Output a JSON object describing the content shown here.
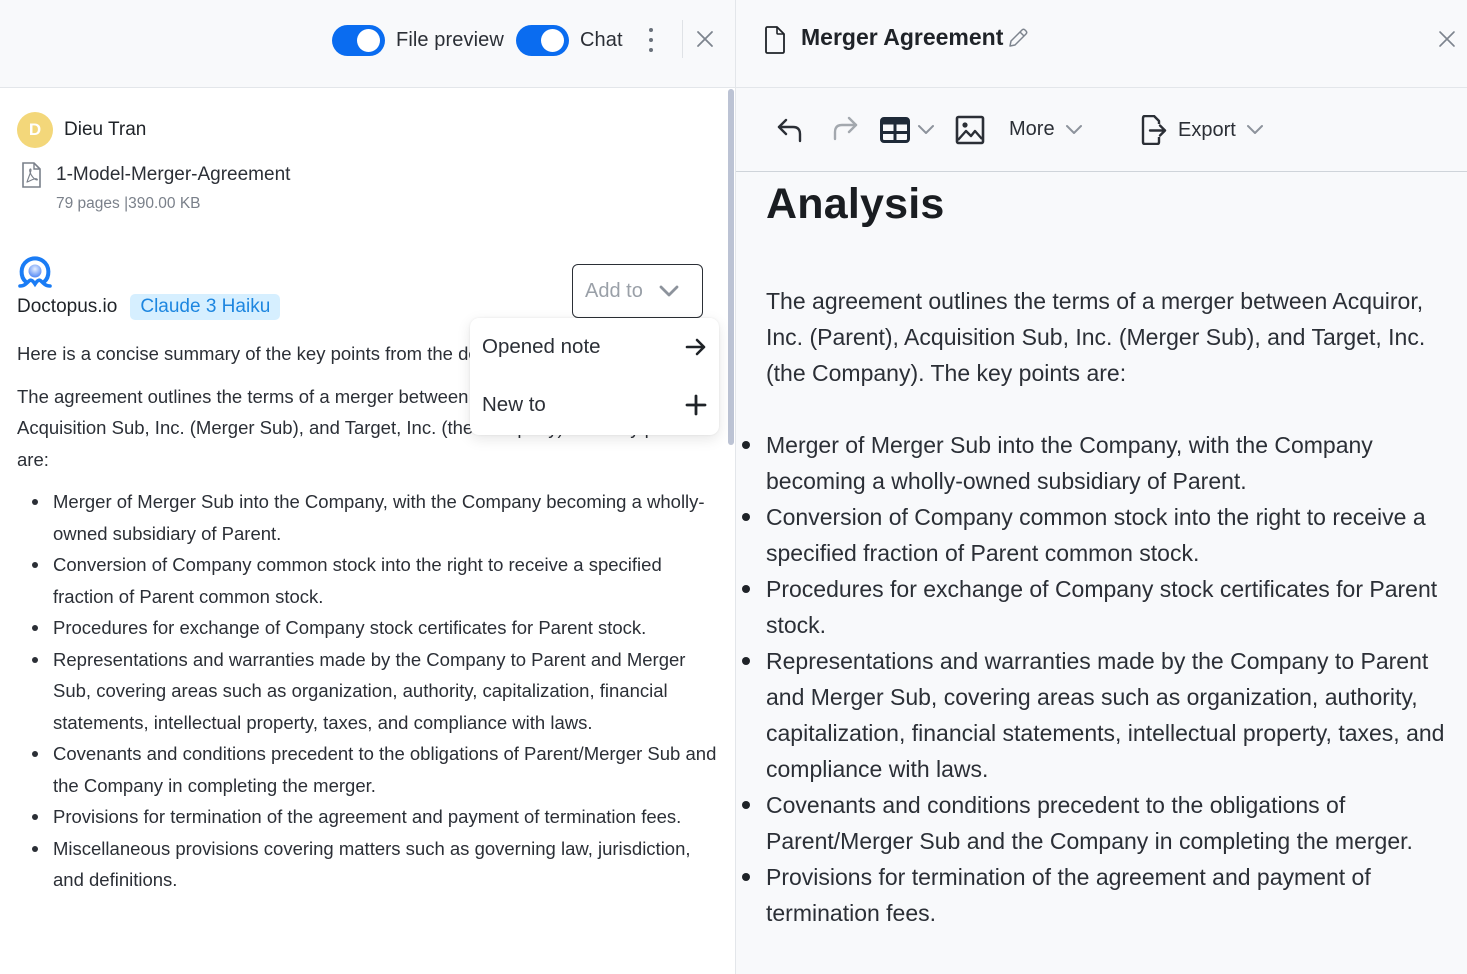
{
  "chat_panel": {
    "header": {
      "file_preview_toggle": {
        "label": "File preview",
        "on": true
      },
      "chat_toggle": {
        "label": "Chat",
        "on": true
      },
      "more_icon": "kebab-vertical-icon",
      "close_icon": "close-icon"
    },
    "user_message": {
      "avatar_initial": "D",
      "avatar_color": "#f3d77a",
      "user_name": "Dieu Tran",
      "attachment": {
        "icon": "pdf-file-icon",
        "file_name": "1-Model-Merger-Agreement",
        "meta": "79 pages |390.00 KB"
      }
    },
    "assistant_message": {
      "brand_name": "Doctopus.io",
      "model_badge": "Claude 3 Haiku",
      "add_to_button": "Add to",
      "add_to_menu": [
        {
          "label": "Opened note",
          "icon": "arrow-right-icon"
        },
        {
          "label": "New to",
          "icon": "plus-icon"
        }
      ],
      "intro": "Here is a concise summary of the key points from the document:",
      "paragraph": "The agreement outlines the terms of a merger between Acquiror, Inc. (Parent), Acquisition Sub, Inc. (Merger Sub), and Target, Inc. (the Company). The key points are:",
      "bullets": [
        "Merger of Merger Sub into the Company, with the Company becoming a wholly-owned subsidiary of Parent.",
        "Conversion of Company common stock into the right to receive a specified fraction of Parent common stock.",
        "Procedures for exchange of Company stock certificates for Parent stock.",
        "Representations and warranties made by the Company to Parent and Merger Sub, covering areas such as organization, authority, capitalization, financial statements, intellectual property, taxes, and compliance with laws.",
        "Covenants and conditions precedent to the obligations of Parent/Merger Sub and the Company in completing the merger.",
        "Provisions for termination of the agreement and payment of termination fees.",
        "Miscellaneous provisions covering matters such as governing law, jurisdiction, and definitions."
      ]
    }
  },
  "note_panel": {
    "title": "Merger Agreement",
    "toolbar": {
      "undo": "undo-icon",
      "redo": "redo-icon",
      "table": "table-icon",
      "image": "image-icon",
      "more_label": "More",
      "export_label": "Export"
    },
    "document": {
      "heading": "Analysis",
      "paragraph": "The agreement outlines the terms of a merger between Acquiror, Inc. (Parent), Acquisition Sub, Inc. (Merger Sub), and Target, Inc. (the Company). The key points are:",
      "bullets": [
        "Merger of Merger Sub into the Company, with the Company becoming a wholly-owned subsidiary of Parent.",
        "Conversion of Company common stock into the right to receive a specified fraction of Parent common stock.",
        "Procedures for exchange of Company stock certificates for Parent stock.",
        "Representations and warranties made by the Company to Parent and Merger Sub, covering areas such as organization, authority, capitalization, financial statements, intellectual property, taxes, and compliance with laws.",
        "Covenants and conditions precedent to the obligations of Parent/Merger Sub and the Company in completing the merger.",
        "Provisions for termination of the agreement and payment of termination fees."
      ]
    }
  },
  "colors": {
    "toggle_on": "#0a6cf0",
    "badge_bg": "#d6efff",
    "badge_text": "#1d86e0",
    "brand_blue": "#1a7cf5",
    "scrollbar": "#bcc3d4"
  }
}
